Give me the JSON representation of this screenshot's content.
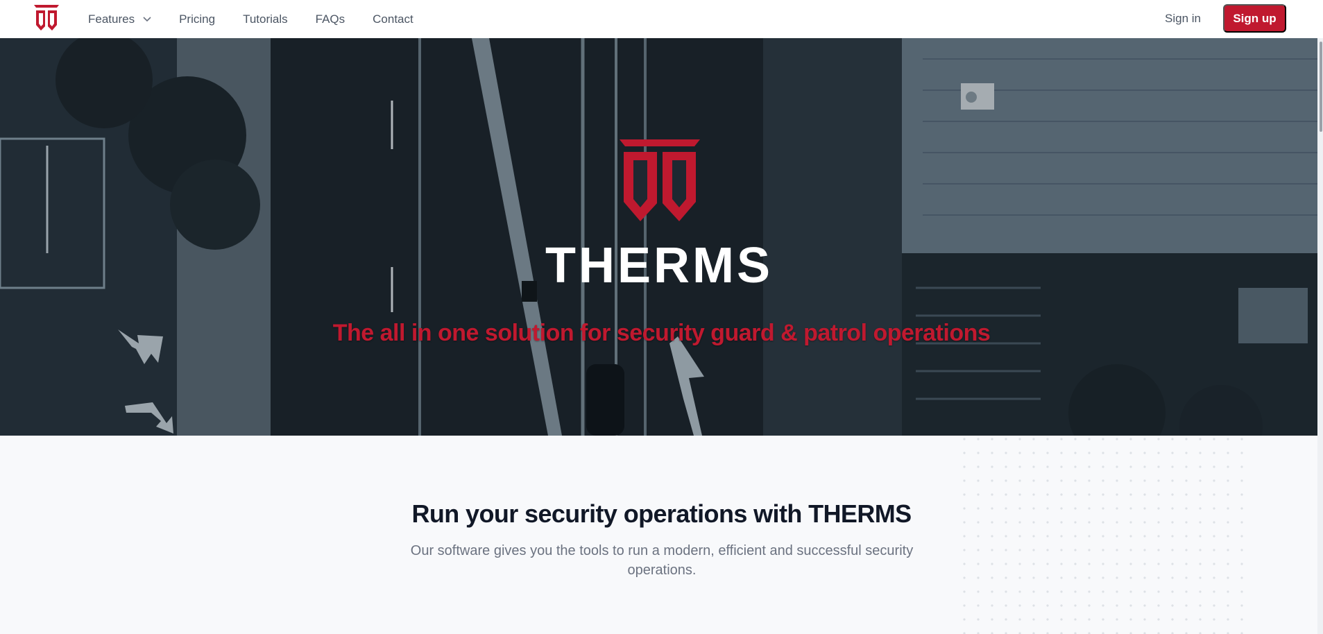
{
  "brand": {
    "accent": "#c0192f",
    "logo_icon": "therms-shield-logo-icon"
  },
  "nav": {
    "items": [
      {
        "label": "Features",
        "has_dropdown": true
      },
      {
        "label": "Pricing"
      },
      {
        "label": "Tutorials"
      },
      {
        "label": "FAQs"
      },
      {
        "label": "Contact"
      }
    ],
    "signin_label": "Sign in",
    "signup_label": "Sign up"
  },
  "hero": {
    "wordmark": "THERMS",
    "tagline": "The all in one solution for security guard & patrol operations"
  },
  "section": {
    "title": "Run your security operations with THERMS",
    "subtitle": "Our software gives you the tools to run a modern, efficient and successful security operations."
  }
}
